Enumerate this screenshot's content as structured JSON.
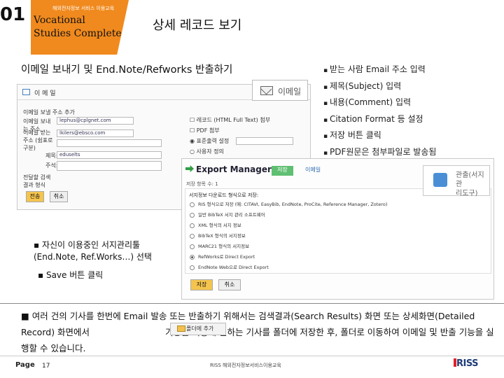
{
  "header": {
    "number": "01",
    "subtitle": "해외전자정보 서비스 이용교육",
    "title_line1": "Vocational",
    "title_line2": "Studies Complete",
    "page_heading": "상세 레코드 보기"
  },
  "section_title": "이메일 보내기 및 End.Note/Refworks 반출하기",
  "bullets": [
    "받는 사람 Email 주소 입력",
    "제목(Subject) 입력",
    "내용(Comment) 입력",
    "Citation Format 등 설정",
    "저장 버튼 클릭",
    "PDF원문은 첨부파일로 발송됨"
  ],
  "email_panel": {
    "header": "이 메 일",
    "rows": [
      "이메일 보낼 주소 추가",
      "이메일 보내는 주소",
      "이메일 받는 주소 (쉼표로 구분)",
      "제목:",
      "주석:",
      "전달할 검색 결과 형식"
    ],
    "values": [
      "lephus@cplgnet.com",
      "lkilers@ebsco.com",
      "",
      "eduselts",
      ""
    ],
    "options": [
      "레코드 (HTML Full Text) 첨부",
      "PDF 첨부",
      "표준출력 설정",
      "사용자 정의"
    ],
    "send_label": "전송",
    "cancel_label": "취소"
  },
  "mail_button_label": "이메일",
  "export_panel": {
    "title": "Export Manager",
    "tab_save": "저장",
    "tab_email": "이메일",
    "sub": "저장 항목 수: 1",
    "box_heading": "서지정보 다운로드 형식으로 저장:",
    "options": [
      "RIS 형식으로 저장 (예: CITAVI, EasyBib, EndNote, ProCite, Reference Manager, Zotero)",
      "일반 BibTeX 서지 관리 소프트웨어",
      "XML 형식의 서지 정보",
      "BibTeX 형식의 서지정보",
      "MARC21 형식의 서지정보",
      "RefWorks로 Direct Export",
      "EndNote Web으로 Direct Export"
    ],
    "selected_index": 5,
    "save_label": "저장",
    "cancel_label": "취소"
  },
  "callout_text_line1": "관출(서지관",
  "callout_text_line2": "리도구)",
  "note1_line1": "▪ 자신이 이용중인 서지관리툴",
  "note1_line2": "(End.Note, Ref.Works…) 선택",
  "note2": "▪ Save 버튼 클릭",
  "paragraph_part1": "■ 여러 건의 기사를 한번에 Email 발송 또는 반출하기 위해서는 검색결과(Search Results) 화면 또는 상세화면(Detailed Record) 화면에서",
  "paragraph_part2": "기능을 이용해 원하는 기사를 폴더에 저장한 후, 폴더로 이동하여 이메일 및 반출 기능을 실행할 수 있습니다.",
  "folder_button_label": "폴더에 추가",
  "footer": {
    "page_label": "Page",
    "page_number": "17",
    "center_text": "RISS 해외전자정보서비스이용교육",
    "logo_text": "RISS"
  },
  "colors": {
    "accent_orange": "#f08a1e",
    "export_green": "#2f9e44",
    "brand_navy": "#1e3c78",
    "brand_red": "#e2222a"
  }
}
